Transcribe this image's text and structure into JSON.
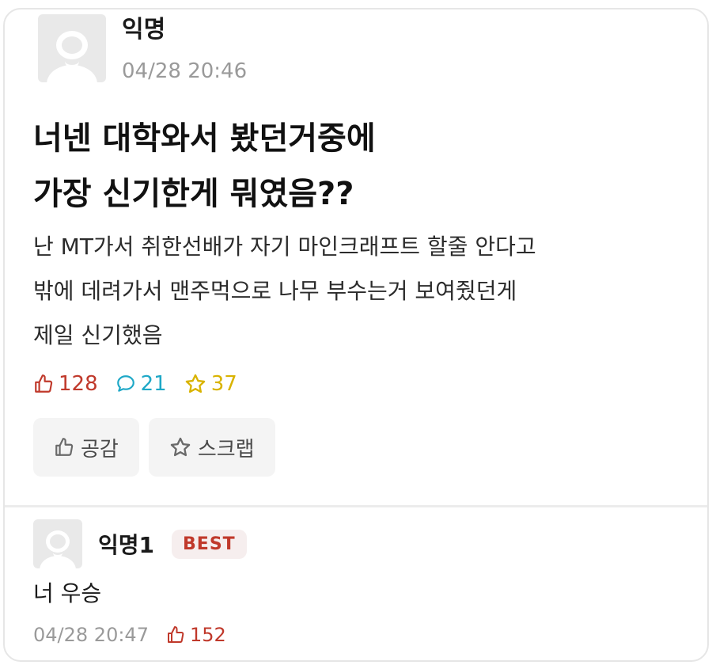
{
  "post": {
    "author": "익명",
    "time": "04/28 20:46",
    "title_lines": [
      "너넨 대학와서 봤던거중에",
      "가장 신기한게 뭐였음??"
    ],
    "body_lines": [
      "난 MT가서 취한선배가 자기 마인크래프트 할줄 안다고",
      "밖에 데려가서 맨주먹으로 나무 부수는거 보여줬던게",
      "제일 신기했음"
    ],
    "stats": {
      "likes": "128",
      "comments": "21",
      "scraps": "37"
    },
    "actions": {
      "like_label": "공감",
      "scrap_label": "스크랩"
    }
  },
  "comment": {
    "author": "익명1",
    "badge": "BEST",
    "text": "너 우승",
    "time": "04/28 20:47",
    "likes": "152"
  },
  "icons": {
    "like": "thumbs-up-icon",
    "comment": "speech-bubble-icon",
    "scrap": "star-icon"
  },
  "colors": {
    "like": "#c0392b",
    "comment": "#1ea8c7",
    "scrap": "#d9b300",
    "muted": "#9a9a9a"
  }
}
